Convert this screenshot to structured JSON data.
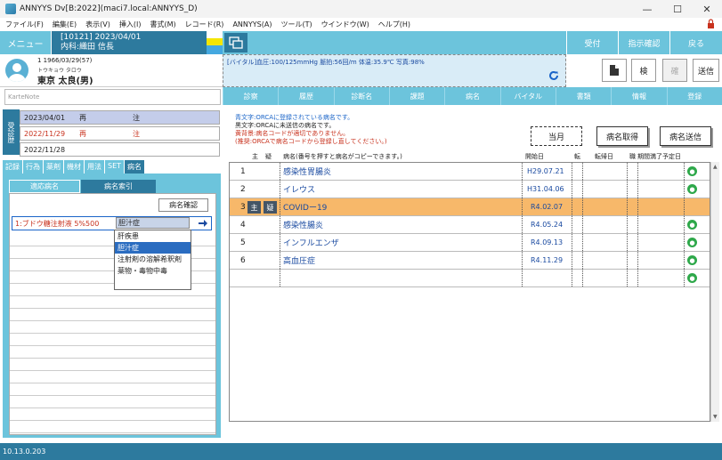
{
  "window": {
    "title": "ANNYYS Dv[B:2022](maci7.local:ANNYYS_D)"
  },
  "menu": [
    "ファイル(F)",
    "編集(E)",
    "表示(V)",
    "挿入(I)",
    "書式(M)",
    "レコード(R)",
    "ANNYYS(A)",
    "ツール(T)",
    "ウインドウ(W)",
    "ヘルプ(H)"
  ],
  "header": {
    "menu_label": "メニュー",
    "id_date": "[10121] 2023/04/01",
    "dept": "内科:織田 信長",
    "reception": "受付",
    "instructions": "指示確認",
    "back": "戻る"
  },
  "colors": {
    "header_dark": "#2d7a9e",
    "header_light": "#6cc4dc",
    "selected_row": "#f7b86a",
    "legend_blue": "#1a64c8",
    "legend_red": "#c8321e",
    "strip_1": "#ffffff",
    "strip_2": "#f5e600",
    "strip_3": "#44a8e0"
  },
  "patient": {
    "dob": "1 1966/03/29(57)",
    "kana": "トウキョウ タロウ",
    "name": "東京 太良(男)"
  },
  "vitals": {
    "text": "[バイタル]血圧:100/125mmHg 脈拍:56回/m 体温:35.9℃ 写真:98%"
  },
  "toolbar": {
    "ken": "検",
    "kaku": "確",
    "send": "送信"
  },
  "karte": {
    "placeholder": "KarteNote"
  },
  "tabs": [
    "診察",
    "履歴",
    "診断名",
    "課題",
    "病名",
    "バイタル",
    "書類",
    "情報",
    "登録"
  ],
  "visits": {
    "label": "受診歴",
    "items": [
      {
        "date": "2023/04/01",
        "kind": "再",
        "note": "注"
      },
      {
        "date": "2022/11/29",
        "kind": "再",
        "note": "注"
      },
      {
        "date": "2022/11/28",
        "kind": "",
        "note": ""
      }
    ]
  },
  "left_tabs": [
    "記録",
    "行為",
    "薬剤",
    "機材",
    "用法",
    "SET",
    "病名"
  ],
  "subtabs": {
    "applicable": "適応病名",
    "index": "病名索引"
  },
  "left": {
    "confirm": "病名確認",
    "input_value": "1:ブドウ糖注射液 5%500",
    "input_search": "胆汁症",
    "dropdown": [
      "肝疾患",
      "胆汁症",
      "注射剤の溶解希釈剤",
      "薬物・毒物中毒"
    ]
  },
  "legend": {
    "blue": "青文字:ORCAに登録されている病名です。",
    "black": "黒文字:ORCAに未送信の病名です。",
    "yellow": "黄背景:病名コードが適切でありません。",
    "yellow2": "(推奨:ORCAで病名コードから登録し直してください。)"
  },
  "buttons": {
    "month": "当月",
    "get": "病名取得",
    "send": "病名送信"
  },
  "columns": {
    "main": "主",
    "susp": "疑",
    "name": "病名(番号を押すと病名がコピーできます。)",
    "start": "開始日",
    "outcome": "転",
    "end": "転帰日",
    "flag": "職",
    "expire": "期間満了予定日"
  },
  "badges": {
    "main": "主",
    "susp": "疑"
  },
  "diseases": [
    {
      "no": "1",
      "name": "感染性胃腸炎",
      "start": "H29.07.21",
      "sel": false
    },
    {
      "no": "2",
      "name": "イレウス",
      "start": "H31.04.06",
      "sel": false
    },
    {
      "no": "3",
      "name": "COVIDー19",
      "start": "R4.02.07",
      "sel": true
    },
    {
      "no": "4",
      "name": "感染性腸炎",
      "start": "R4.05.24",
      "sel": false
    },
    {
      "no": "5",
      "name": "インフルエンザ",
      "start": "R4.09.13",
      "sel": false
    },
    {
      "no": "6",
      "name": "高血圧症",
      "start": "R4.11.29",
      "sel": false
    }
  ],
  "status": {
    "version": "10.13.0.203"
  }
}
